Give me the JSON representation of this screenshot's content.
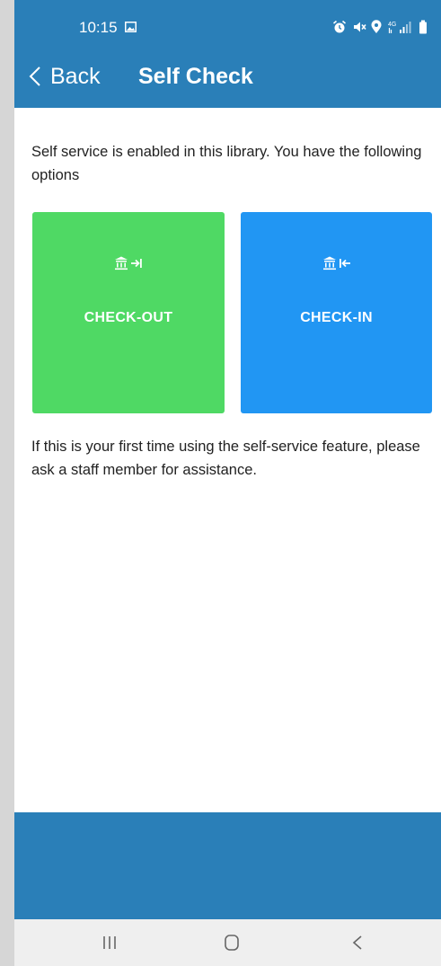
{
  "status_bar": {
    "time": "10:15",
    "icons": [
      "gallery-icon",
      "alarm-icon",
      "mute-icon",
      "location-icon",
      "4g-signal-icon",
      "battery-icon"
    ]
  },
  "app_bar": {
    "back_label": "Back",
    "title": "Self Check"
  },
  "main": {
    "intro_text": "Self service is enabled in this library. You have the following options",
    "tiles": [
      {
        "label": "CHECK-OUT",
        "icon": "library-checkout-icon",
        "color": "#4fd964"
      },
      {
        "label": "CHECK-IN",
        "icon": "library-checkin-icon",
        "color": "#2196f3"
      }
    ],
    "help_text": "If this is your first time using the self-service feature, please ask a staff member for assistance."
  },
  "colors": {
    "brand": "#2a7fb8",
    "background": "#ffffff",
    "page_margin": "#d6d6d6",
    "nav_bar": "#efefef"
  },
  "nav_bar": {
    "buttons": [
      "recents-icon",
      "home-icon",
      "back-icon"
    ]
  }
}
